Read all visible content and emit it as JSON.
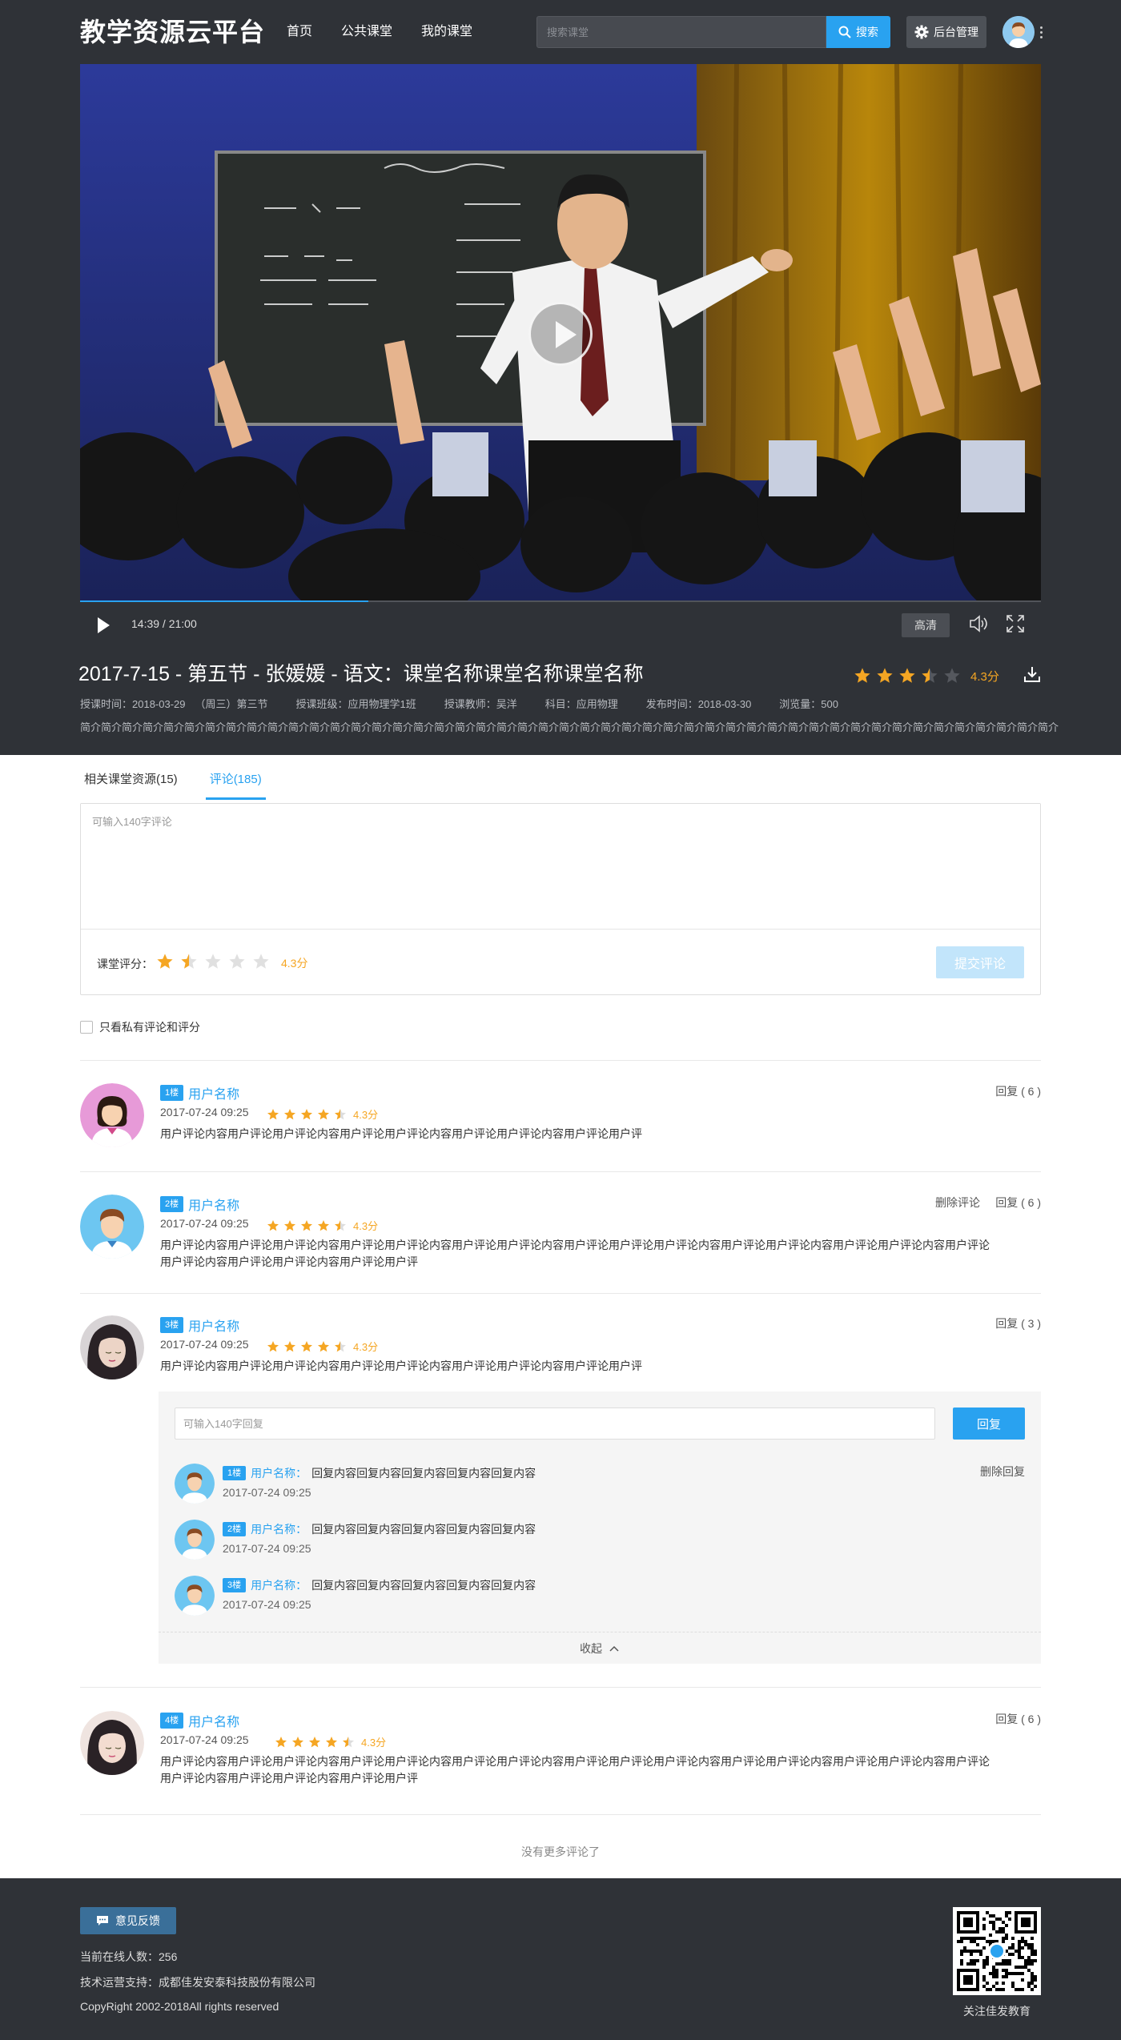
{
  "header": {
    "logo": "教学资源云平台",
    "nav": [
      "首页",
      "公共课堂",
      "我的课堂"
    ],
    "search_placeholder": "搜索课堂",
    "search_button": "搜索",
    "admin_button": "后台管理"
  },
  "player": {
    "time": "14:39 / 21:00",
    "progress": 0.3,
    "quality": "高清"
  },
  "lesson": {
    "title": "2017-7-15 - 第五节 - 张媛媛 - 语文：课堂名称课堂名称课堂名称",
    "rating": 3.5,
    "score": "4.3分",
    "meta": {
      "time_label": "授课时间：",
      "time": "2018-03-29",
      "weekday": "（周三）第三节",
      "class": "授课班级：应用物理学1班",
      "teacher": "授课教师：吴洋",
      "subject": "科目：应用物理",
      "publish": "发布时间：2018-03-30",
      "views": "浏览量：500"
    },
    "intro": "简介简介简介简介简介简介简介简介简介简介简介简介简介简介简介简介简介简介简介简介简介简介简介简介简介简介简介简介简介简介简介简介简介简介简介简介简介简介简介简介简介简介简介简介简介简介简介"
  },
  "tabs": [
    "相关课堂资源(15)",
    "评论(185)"
  ],
  "comment_form": {
    "placeholder": "可输入140字评论",
    "rating_label": "课堂评分：",
    "rating": 1.5,
    "score": "4.3分",
    "submit": "提交评论"
  },
  "filter_label": "只看私有评论和评分",
  "comments": [
    {
      "floor": "1楼",
      "user": "用户名称",
      "date": "2017-07-24 09:25",
      "rating": 4.5,
      "score": "4.3分",
      "text": "用户评论内容用户评论用户评论内容用户评论用户评论内容用户评论用户评论内容用户评论用户评",
      "reply": "回复 ( 6 )"
    },
    {
      "floor": "2楼",
      "user": "用户名称",
      "date": "2017-07-24 09:25",
      "rating": 4.5,
      "score": "4.3分",
      "text": "用户评论内容用户评论用户评论内容用户评论用户评论内容用户评论用户评论内容用户评论用户评论用户评论内容用户评论用户评论内容用户评论用户评论内容用户评论用户评论内容用户评论用户评论内容用户评论用户评",
      "delete": "删除评论",
      "reply": "回复 ( 6 )"
    },
    {
      "floor": "3楼",
      "user": "用户名称",
      "date": "2017-07-24 09:25",
      "rating": 4.5,
      "score": "4.3分",
      "text": "用户评论内容用户评论用户评论内容用户评论用户评论内容用户评论用户评论内容用户评论用户评",
      "reply": "回复 ( 3 )",
      "reply_form": {
        "placeholder": "可输入140字回复",
        "button": "回复"
      },
      "replies": [
        {
          "floor": "1楼",
          "user": "用户名称：",
          "text": "回复内容回复内容回复内容回复内容回复内容",
          "date": "2017-07-24 09:25",
          "delete": "删除回复"
        },
        {
          "floor": "2楼",
          "user": "用户名称：",
          "text": "回复内容回复内容回复内容回复内容回复内容",
          "date": "2017-07-24 09:25"
        },
        {
          "floor": "3楼",
          "user": "用户名称：",
          "text": "回复内容回复内容回复内容回复内容回复内容",
          "date": "2017-07-24 09:25"
        }
      ],
      "collapse": "收起"
    },
    {
      "floor": "4楼",
      "user": "用户名称",
      "date": "2017-07-24 09:25",
      "rating": 4.5,
      "score": "4.3分",
      "text": "用户评论内容用户评论用户评论内容用户评论用户评论内容用户评论用户评论内容用户评论用户评论用户评论内容用户评论用户评论内容用户评论用户评论内容用户评论用户评论内容用户评论用户评论内容用户评论用户评",
      "reply": "回复 ( 6 )"
    }
  ],
  "no_more": "没有更多评论了",
  "footer": {
    "feedback": "意见反馈",
    "online": "当前在线人数：256",
    "support": "技术运营支持：成都佳发安泰科技股份有限公司",
    "copyright": "CopyRight 2002-2018All rights reserved",
    "qr_label": "关注佳发教育"
  },
  "colors": {
    "accent": "#29a2f0",
    "star": "#f5a623",
    "dark_bg": "#2f3237"
  }
}
